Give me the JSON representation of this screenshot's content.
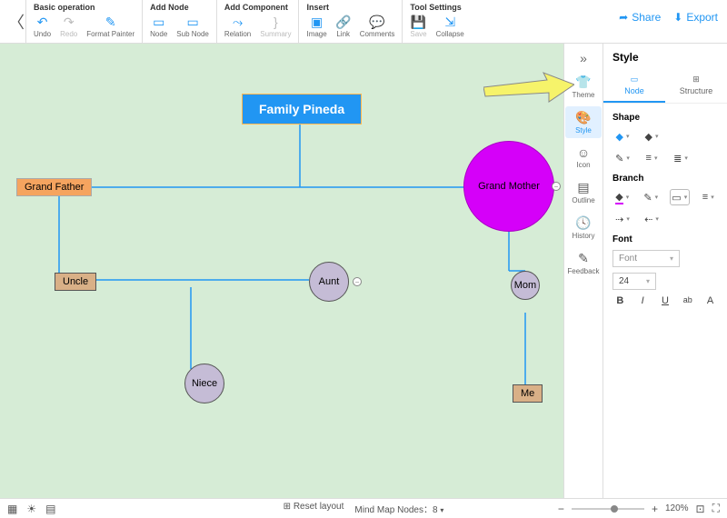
{
  "toolbar": {
    "groups": {
      "basic": {
        "title": "Basic operation",
        "undo": "Undo",
        "redo": "Redo",
        "format_painter": "Format Painter"
      },
      "add_node": {
        "title": "Add Node",
        "node": "Node",
        "sub_node": "Sub Node"
      },
      "add_component": {
        "title": "Add Component",
        "relation": "Relation",
        "summary": "Summary"
      },
      "insert": {
        "title": "Insert",
        "image": "Image",
        "link": "Link",
        "comments": "Comments"
      },
      "tool_settings": {
        "title": "Tool Settings",
        "save": "Save",
        "collapse": "Collapse"
      }
    },
    "share": "Share",
    "export": "Export"
  },
  "diagram": {
    "root": "Family Pineda",
    "nodes": {
      "grand_father": "Grand Father",
      "grand_mother": "Grand Mother",
      "uncle": "Uncle",
      "aunt": "Aunt",
      "mom": "Mom",
      "niece": "Niece",
      "me": "Me"
    }
  },
  "side_rail": {
    "theme": "Theme",
    "style": "Style",
    "icon": "Icon",
    "outline": "Outline",
    "history": "History",
    "feedback": "Feedback"
  },
  "panel": {
    "title": "Style",
    "tabs": {
      "node": "Node",
      "structure": "Structure"
    },
    "sections": {
      "shape": "Shape",
      "branch": "Branch",
      "font": "Font"
    },
    "font_placeholder": "Font",
    "font_size": "24"
  },
  "status": {
    "reset_layout": "Reset layout",
    "node_count_label": "Mind Map Nodes：",
    "node_count": "8",
    "zoom": "120%"
  }
}
